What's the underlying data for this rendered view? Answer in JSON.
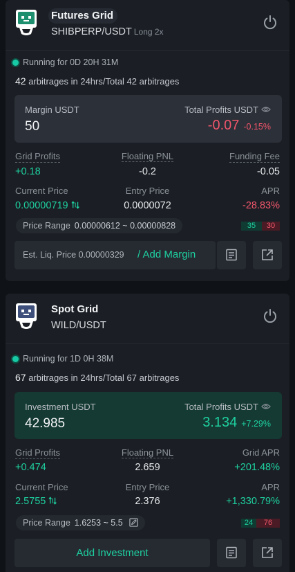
{
  "bots": [
    {
      "title": "Futures Grid",
      "pair": "SHIBPERP/USDT",
      "pair_sub": "Long 2x",
      "running": "Running for 0D 20H 31M",
      "arb_count": "42",
      "arb_text": " arbitrages in 24hrs/Total 42 arbitrages",
      "panel": {
        "left_label": "Margin USDT",
        "left_value": "50",
        "right_label": "Total Profits USDT",
        "right_value": "-0.07",
        "right_pct": "-0.15%"
      },
      "stats": [
        {
          "label": "Grid Profits",
          "value": "+0.18"
        },
        {
          "label": "Floating PNL",
          "value": "-0.2"
        },
        {
          "label": "Funding Fee",
          "value": "-0.05"
        },
        {
          "label": "Current Price",
          "value": "0.00000719"
        },
        {
          "label": "Entry Price",
          "value": "0.0000072"
        },
        {
          "label": "APR",
          "value": "-28.83%"
        }
      ],
      "range_label": "Price Range",
      "range_value": "0.00000612 ~ 0.00000828",
      "bar_green": "35",
      "bar_red": "30",
      "liq_label": "Est. Liq. Price 0.00000329",
      "add_margin": "/ Add Margin"
    },
    {
      "title": "Spot Grid",
      "pair": "WILD/USDT",
      "running": "Running for 1D 0H 38M",
      "arb_count": "67",
      "arb_text": " arbitrages in 24hrs/Total 67 arbitrages",
      "panel": {
        "left_label": "Investment USDT",
        "left_value": "42.985",
        "right_label": "Total Profits USDT",
        "right_value": "3.134",
        "right_pct": "+7.29%"
      },
      "stats": [
        {
          "label": "Grid Profits",
          "value": "+0.474"
        },
        {
          "label": "Floating PNL",
          "value": "2.659"
        },
        {
          "label": "Grid APR",
          "value": "+201.48%"
        },
        {
          "label": "Current Price",
          "value": "2.5755"
        },
        {
          "label": "Entry Price",
          "value": "2.376"
        },
        {
          "label": "APR",
          "value": "+1,330.79%"
        }
      ],
      "range_label": "Price Range",
      "range_value": "1.6253 ~ 5.5",
      "bar_green": "24",
      "bar_red": "76",
      "add_investment": "Add Investment"
    }
  ],
  "colors": {
    "green": "#1ecf9f",
    "red": "#f0556b",
    "bg": "#0f1216",
    "card": "#1b1f25"
  },
  "icons": [
    "robot-icon",
    "power-icon",
    "eye-icon",
    "swap-icon",
    "edit-icon",
    "list-icon",
    "share-icon"
  ]
}
